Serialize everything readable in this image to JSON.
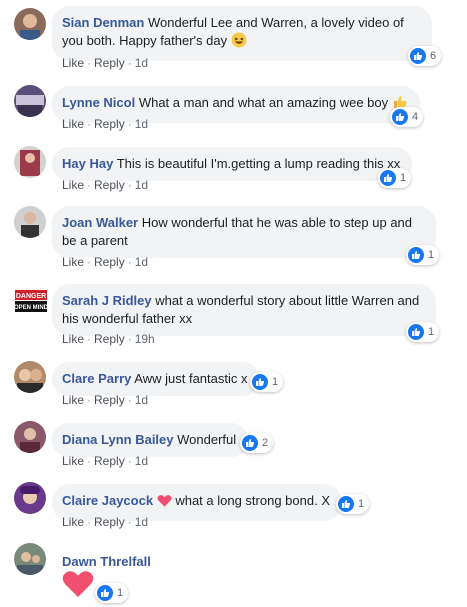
{
  "actions": {
    "like": "Like",
    "reply": "Reply",
    "separator": "·"
  },
  "comments": [
    {
      "name": "Sian Denman",
      "text": "Wonderful Lee and Warren, a lovely video of you both. Happy father's day",
      "emoji": "laughing-emoji",
      "time": "1d",
      "reactions": "6",
      "avatar_color": "#8a6a5a"
    },
    {
      "name": "Lynne Nicol",
      "text": "What a man and what an amazing wee boy",
      "emoji": "thumbs-up-emoji",
      "time": "1d",
      "reactions": "4",
      "avatar_color": "#5a4f7a"
    },
    {
      "name": "Hay Hay",
      "text": "This is beautiful I'm.getting a lump reading this xx",
      "time": "1d",
      "reactions": "1",
      "avatar_color": "#9a3a4a"
    },
    {
      "name": "Joan Walker",
      "text": "How wonderful that he was able to step up and be a parent",
      "time": "1d",
      "reactions": "1",
      "avatar_color": "#6b6b6b"
    },
    {
      "name": "Sarah J Ridley",
      "text": "what a wonderful story about little Warren and his wonderful father xx",
      "time": "19h",
      "reactions": "1",
      "avatar_label": "DANGER OPEN MIND"
    },
    {
      "name": "Clare Parry",
      "text": "Aww just fantastic x",
      "time": "1d",
      "reactions": "1",
      "avatar_color": "#b08a6a"
    },
    {
      "name": "Diana Lynn Bailey",
      "text": "Wonderful",
      "time": "1d",
      "reactions": "2",
      "avatar_color": "#8a5a6a"
    },
    {
      "name": "Claire Jaycock",
      "text": "what a long strong bond. X",
      "emoji": "heart-emoji",
      "time": "1d",
      "reactions": "1",
      "avatar_color": "#6a3a8a"
    },
    {
      "name": "Dawn Threlfall",
      "text": "",
      "emoji": "heart-emoji",
      "reactions": "1",
      "avatar_color": "#7a8a7a"
    }
  ],
  "colors": {
    "name": "#385898",
    "like_blue": "#1877f2",
    "bubble": "#f2f3f5",
    "heart": "#f0506e"
  }
}
